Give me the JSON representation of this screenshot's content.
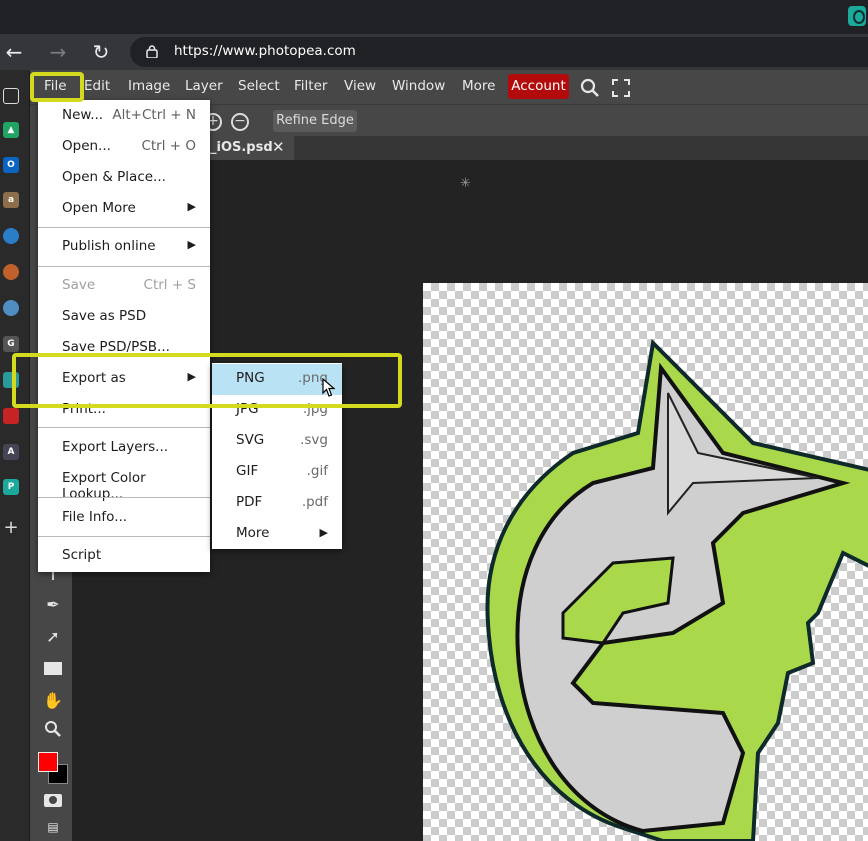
{
  "browser": {
    "url": "https://www.photopea.com",
    "nav_back_icon": "back-arrow-icon",
    "nav_forward_icon": "forward-arrow-icon",
    "reload_icon": "reload-icon"
  },
  "menubar": {
    "items": [
      "File",
      "Edit",
      "Image",
      "Layer",
      "Select",
      "Filter",
      "View",
      "Window",
      "More"
    ],
    "account": "Account",
    "account_color": "#b30b0b"
  },
  "tool_options": {
    "refine_edge": "Refine Edge"
  },
  "document_tab": {
    "name": "_iOS.psd",
    "close": "✕"
  },
  "file_menu": {
    "new": {
      "label": "New...",
      "shortcut": "Alt+Ctrl + N"
    },
    "open": {
      "label": "Open...",
      "shortcut": "Ctrl + O"
    },
    "open_place": {
      "label": "Open & Place..."
    },
    "open_more": {
      "label": "Open More"
    },
    "publish_online": {
      "label": "Publish online"
    },
    "save": {
      "label": "Save",
      "shortcut": "Ctrl + S"
    },
    "save_psd": {
      "label": "Save as PSD"
    },
    "save_psd_psb": {
      "label": "Save PSD/PSB..."
    },
    "export_as": {
      "label": "Export as"
    },
    "print": {
      "label": "Print..."
    },
    "export_layers": {
      "label": "Export Layers..."
    },
    "export_color_lookup": {
      "label": "Export Color Lookup..."
    },
    "file_info": {
      "label": "File Info..."
    },
    "script": {
      "label": "Script"
    }
  },
  "export_submenu": {
    "png": {
      "label": "PNG",
      "ext": ".png"
    },
    "jpg": {
      "label": "JPG",
      "ext": ".jpg"
    },
    "svg": {
      "label": "SVG",
      "ext": ".svg"
    },
    "gif": {
      "label": "GIF",
      "ext": ".gif"
    },
    "pdf": {
      "label": "PDF",
      "ext": ".pdf"
    },
    "more": {
      "label": "More"
    }
  },
  "colors": {
    "highlight_box": "#d4db1e",
    "menu_hover": "#b9e2f5",
    "foreground": "#ff0000",
    "background": "#000000"
  }
}
